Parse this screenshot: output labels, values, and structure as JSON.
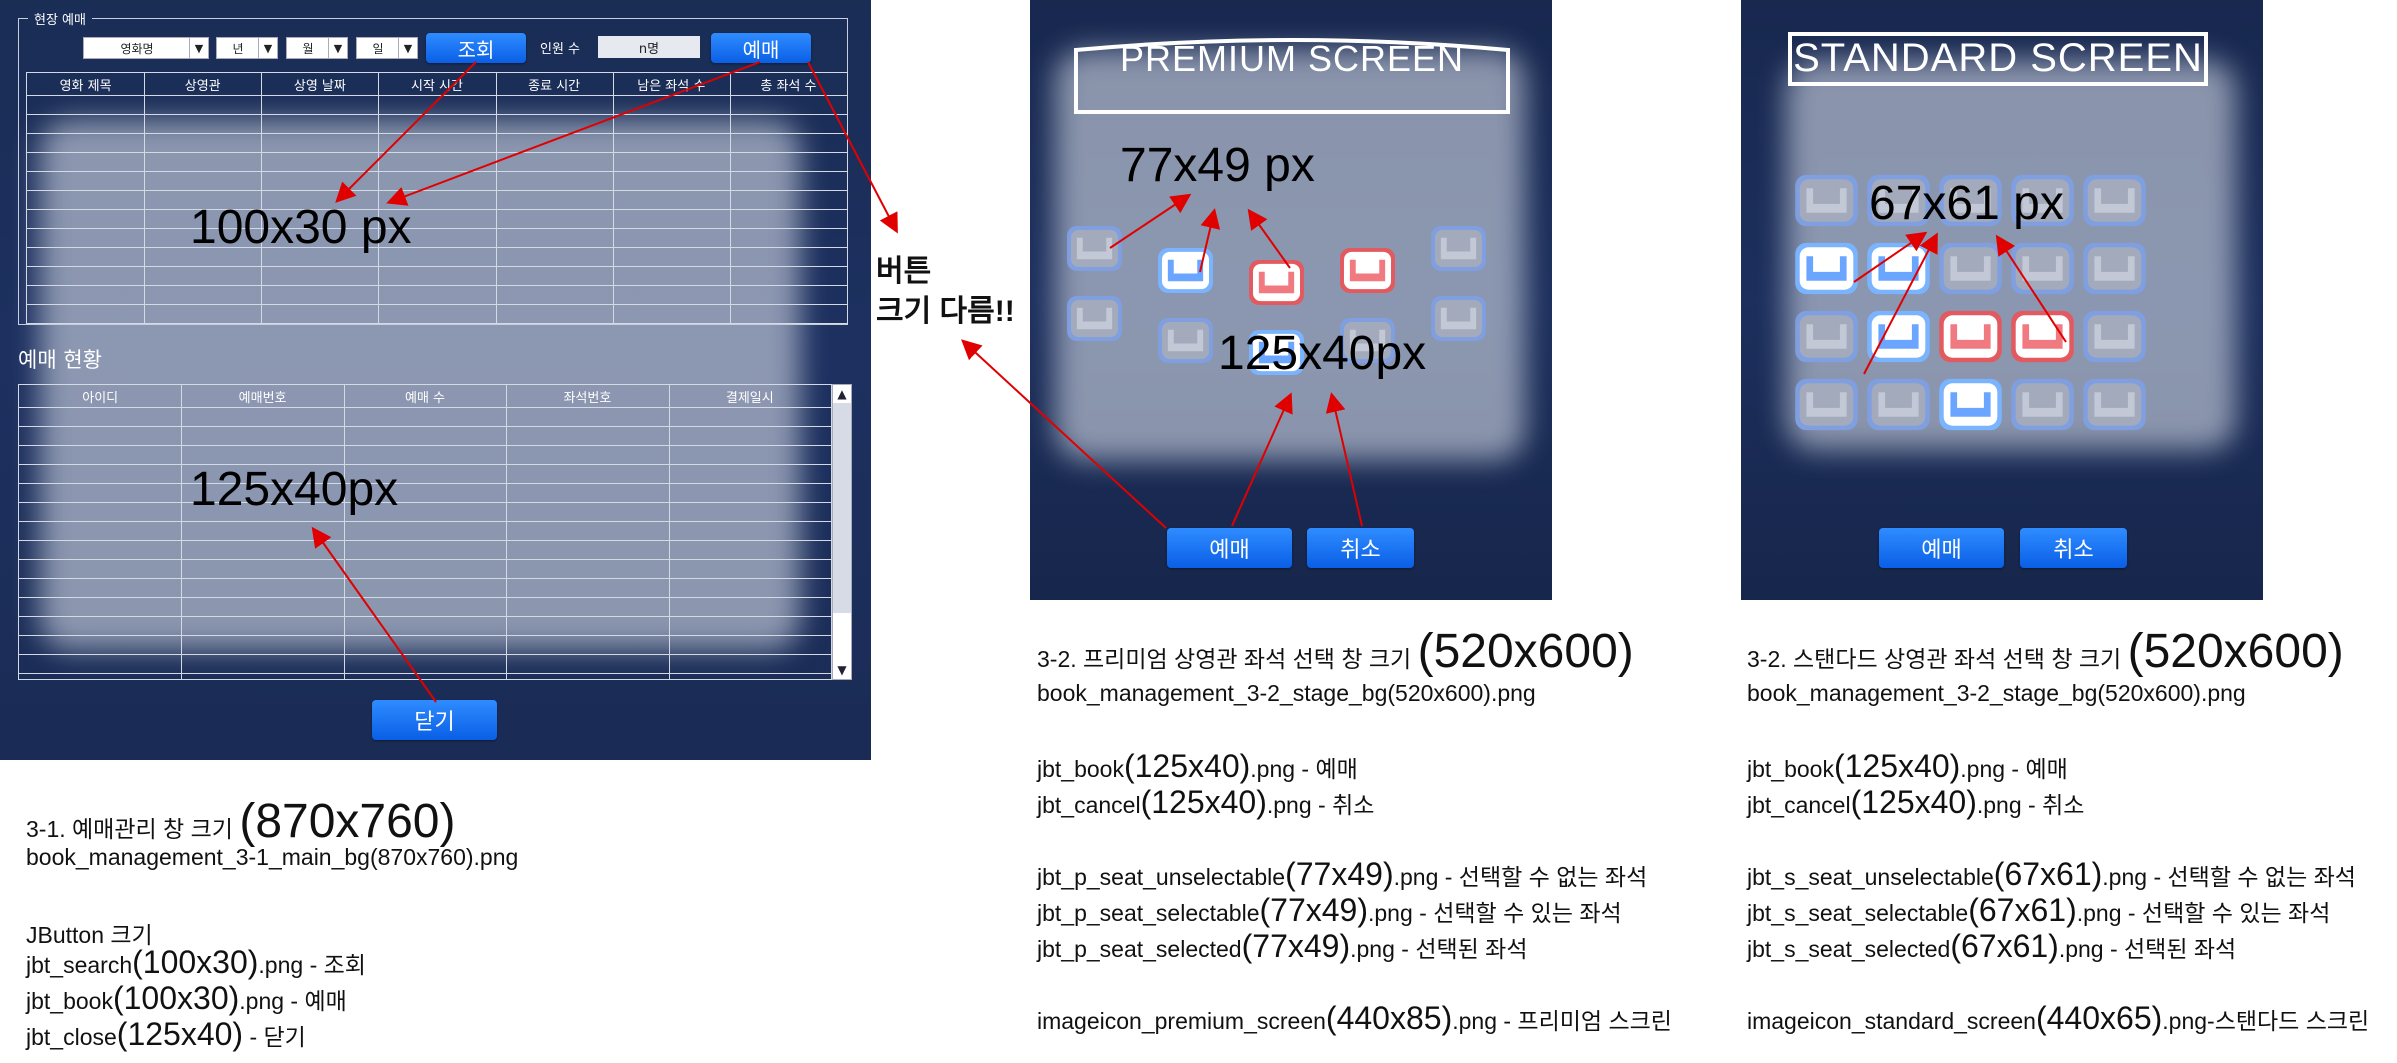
{
  "panel1": {
    "legend": "현장 예매",
    "combos": [
      "영화명",
      "년",
      "월",
      "일"
    ],
    "search_label": "조회",
    "people_label": "인원 수",
    "people_value": "n명",
    "book_label": "예매",
    "top_headers": [
      "영화 제목",
      "상영관",
      "상영 날짜",
      "시작 시간",
      "종료 시간",
      "남은 좌석 수",
      "총 좌석 수"
    ],
    "status_title": "예매 현황",
    "bottom_headers": [
      "아이디",
      "예매번호",
      "예매 수",
      "좌석번호",
      "결제일시"
    ],
    "close_label": "닫기",
    "annot_top": "100x30 px",
    "annot_bottom": "125x40px"
  },
  "mid_note": [
    "버튼",
    "크기 다름!!"
  ],
  "premium": {
    "screen_label": "PREMIUM SCREEN",
    "annot_seat": "77x49 px",
    "annot_btn": "125x40px",
    "book_label": "예매",
    "cancel_label": "취소",
    "seat_rows": [
      [
        "unselectable",
        "selectable",
        "selected",
        "selected",
        "unselectable"
      ],
      [
        "unselectable",
        "unselectable",
        "selectable",
        "unselectable",
        "unselectable"
      ]
    ]
  },
  "standard": {
    "screen_label": "STANDARD SCREEN",
    "annot_seat": "67x61 px",
    "book_label": "예매",
    "cancel_label": "취소",
    "seat_rows": [
      [
        "unselectable",
        "unselectable",
        "unselectable",
        "unselectable",
        "unselectable"
      ],
      [
        "selectable",
        "selectable",
        "unselectable",
        "unselectable",
        "unselectable"
      ],
      [
        "unselectable",
        "selectable",
        "selected",
        "selected",
        "unselectable"
      ],
      [
        "unselectable",
        "unselectable",
        "selectable",
        "unselectable",
        "unselectable"
      ]
    ]
  },
  "desc1": {
    "title": "3-1. 예매관리 창 크기",
    "title_size": "(870x760)",
    "bg": "book_management_3-1_main_bg(870x760).png",
    "jbutton": "JButton 크기",
    "lines": [
      {
        "a": "jbt_search",
        "b": "(100x30)",
        "c": ".png - 조회"
      },
      {
        "a": "jbt_book",
        "b": "(100x30)",
        "c": ".png - 예매"
      },
      {
        "a": "jbt_close",
        "b": "(125x40)",
        "c": " - 닫기"
      }
    ]
  },
  "desc2": {
    "title": "3-2. 프리미엄 상영관 좌석 선택 창 크기",
    "title_size": "(520x600)",
    "bg": "book_management_3-2_stage_bg(520x600).png",
    "lines": [
      {
        "a": "jbt_book",
        "b": "(125x40)",
        "c": ".png - 예매"
      },
      {
        "a": "jbt_cancel",
        "b": "(125x40)",
        "c": ".png - 취소"
      },
      {
        "a": "jbt_p_seat_unselectable",
        "b": "(77x49)",
        "c": ".png - 선택할 수 없는 좌석"
      },
      {
        "a": "jbt_p_seat_selectable",
        "b": "(77x49)",
        "c": ".png - 선택할 수 있는 좌석"
      },
      {
        "a": "jbt_p_seat_selected",
        "b": "(77x49)",
        "c": ".png - 선택된 좌석"
      },
      {
        "a": "imageicon_premium_screen",
        "b": "(440x85)",
        "c": ".png - 프리미엄 스크린"
      }
    ]
  },
  "desc3": {
    "title": "3-2. 스탠다드 상영관 좌석 선택 창 크기",
    "title_size": "(520x600)",
    "bg": "book_management_3-2_stage_bg(520x600).png",
    "lines": [
      {
        "a": "jbt_book",
        "b": "(125x40)",
        "c": ".png - 예매"
      },
      {
        "a": "jbt_cancel",
        "b": "(125x40)",
        "c": ".png - 취소"
      },
      {
        "a": "jbt_s_seat_unselectable",
        "b": "(67x61)",
        "c": ".png - 선택할 수 없는 좌석"
      },
      {
        "a": "jbt_s_seat_selectable",
        "b": "(67x61)",
        "c": ".png - 선택할 수 있는 좌석"
      },
      {
        "a": "jbt_s_seat_selected",
        "b": "(67x61)",
        "c": ".png - 선택된 좌석"
      },
      {
        "a": "imageicon_standard_screen",
        "b": "(440x65)",
        "c": ".png-스탠다드 스크린"
      }
    ]
  },
  "colors": {
    "accent_blue": "#0a63f0",
    "bg_navy": "#1b2d58",
    "selected_red": "#e25a5f",
    "selectable_blue": "#7ab4ff"
  }
}
